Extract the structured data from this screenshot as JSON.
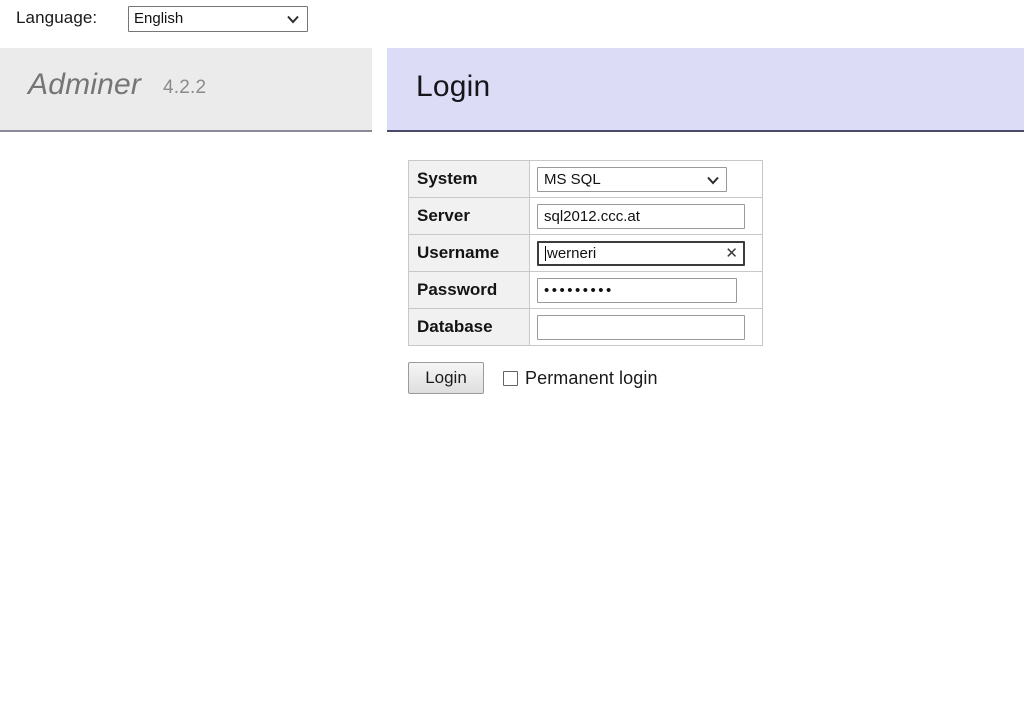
{
  "language_bar": {
    "label": "Language:",
    "selected": "English",
    "chevron_icon": "chevron-down-icon"
  },
  "brand": {
    "name": "Adminer",
    "version": "4.2.2"
  },
  "page": {
    "title": "Login"
  },
  "login_form": {
    "rows": [
      {
        "label": "System",
        "type": "select",
        "value": "MS SQL",
        "placeholder": ""
      },
      {
        "label": "Server",
        "type": "text",
        "value": "sql2012.ccc.at",
        "placeholder": ""
      },
      {
        "label": "Username",
        "type": "text",
        "value": "werneri",
        "placeholder": "",
        "focused": true,
        "clear_icon": "clear-x-icon"
      },
      {
        "label": "Password",
        "type": "password",
        "value": "•••••••••",
        "placeholder": ""
      },
      {
        "label": "Database",
        "type": "text",
        "value": "",
        "placeholder": ""
      }
    ],
    "submit_label": "Login",
    "permanent_login_label": "Permanent login",
    "permanent_login_checked": false
  },
  "colors": {
    "brand_band_bg": "#ebebeb",
    "page_band_bg": "#dcdcf7",
    "label_cell_bg": "#f1f1f1",
    "brand_text": "#757575",
    "page_band_border": "#4a4a6a"
  }
}
